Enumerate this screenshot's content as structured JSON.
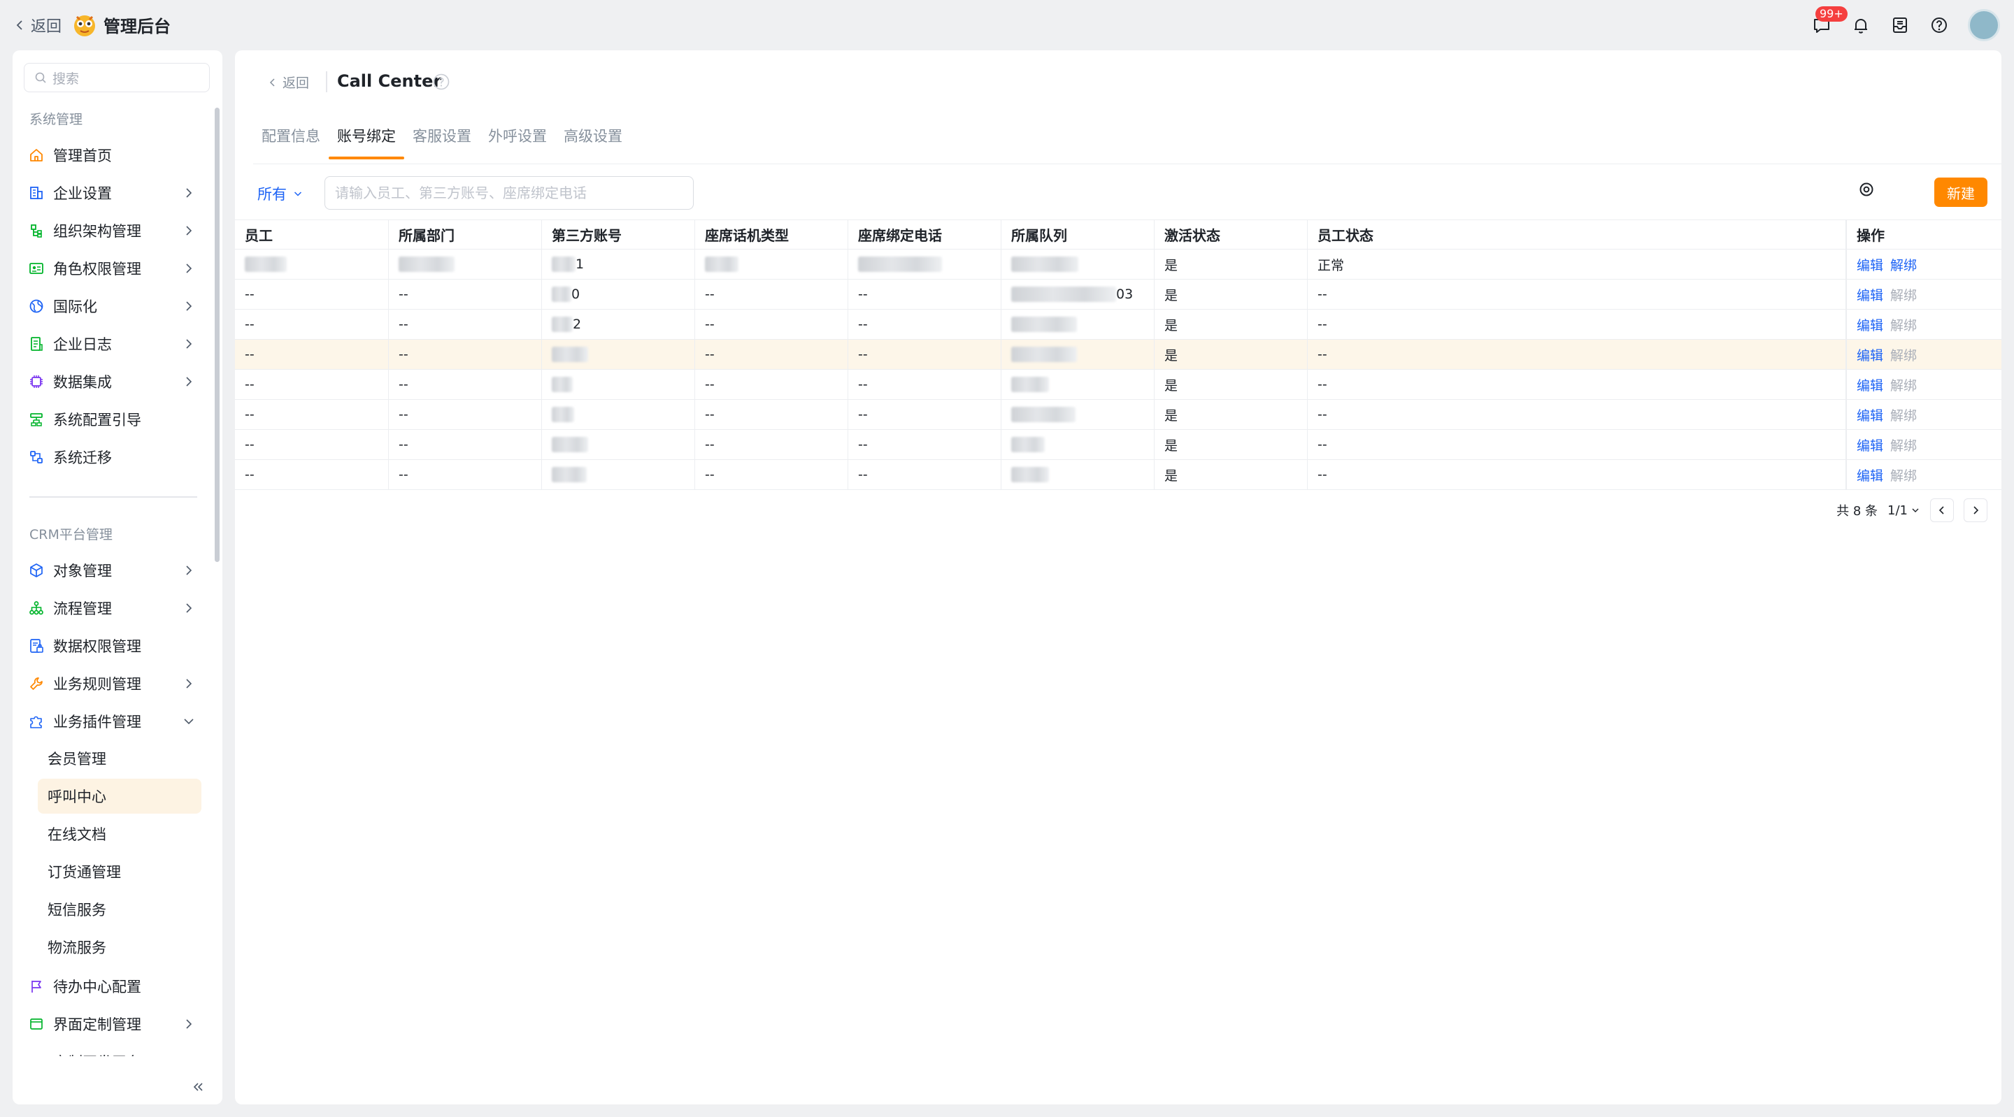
{
  "topbar": {
    "back_label": "返回",
    "app_title": "管理后台",
    "notification_badge": "99+"
  },
  "sidebar": {
    "search_placeholder": "搜索",
    "group1_title": "系统管理",
    "group1_items": [
      {
        "label": "管理首页",
        "icon": "home-icon",
        "has_children": false
      },
      {
        "label": "企业设置",
        "icon": "building-icon",
        "has_children": true
      },
      {
        "label": "组织架构管理",
        "icon": "org-tree-icon",
        "has_children": true
      },
      {
        "label": "角色权限管理",
        "icon": "role-card-icon",
        "has_children": true
      },
      {
        "label": "国际化",
        "icon": "globe-icon",
        "has_children": true
      },
      {
        "label": "企业日志",
        "icon": "log-icon",
        "has_children": true
      },
      {
        "label": "数据集成",
        "icon": "chip-icon",
        "has_children": true
      },
      {
        "label": "系统配置引导",
        "icon": "guide-icon",
        "has_children": false
      },
      {
        "label": "系统迁移",
        "icon": "migrate-icon",
        "has_children": false
      }
    ],
    "group2_title": "CRM平台管理",
    "group2_items": [
      {
        "label": "对象管理",
        "icon": "cube-icon",
        "has_children": true
      },
      {
        "label": "流程管理",
        "icon": "flow-icon",
        "has_children": true
      },
      {
        "label": "数据权限管理",
        "icon": "data-lock-icon",
        "has_children": false
      },
      {
        "label": "业务规则管理",
        "icon": "wrench-icon",
        "has_children": true
      },
      {
        "label": "业务插件管理",
        "icon": "puzzle-icon",
        "has_children": true,
        "expanded": true
      }
    ],
    "plugin_subitems": [
      "会员管理",
      "呼叫中心",
      "在线文档",
      "订货通管理",
      "短信服务",
      "物流服务"
    ],
    "active_subitem": "呼叫中心",
    "group2_items_after": [
      {
        "label": "待办中心配置",
        "icon": "flag-icon",
        "has_children": false
      },
      {
        "label": "界面定制管理",
        "icon": "layout-icon",
        "has_children": true
      },
      {
        "label": "定制开发平台",
        "icon": "code-icon",
        "has_children": true
      }
    ]
  },
  "main": {
    "back_label": "返回",
    "page_title": "Call Center",
    "tabs": [
      "配置信息",
      "账号绑定",
      "客服设置",
      "外呼设置",
      "高级设置"
    ],
    "active_tab": "账号绑定",
    "filter_label": "所有",
    "search_placeholder": "请输入员工、第三方账号、座席绑定电话",
    "new_button": "新建",
    "columns": [
      "员工",
      "所属部门",
      "第三方账号",
      "座席话机类型",
      "座席绑定电话",
      "所属队列",
      "激活状态",
      "员工状态",
      "操作"
    ],
    "rows": [
      {
        "employee": "",
        "dept": "",
        "account": "1",
        "phone_type": "",
        "bound_phone": "",
        "queue": "",
        "active": "是",
        "status": "正常",
        "edit": "编辑",
        "unbind": "解绑",
        "unbind_enabled": true
      },
      {
        "employee": "--",
        "dept": "--",
        "account": "0",
        "phone_type": "--",
        "bound_phone": "--",
        "queue": "03",
        "active": "是",
        "status": "--",
        "edit": "编辑",
        "unbind": "解绑",
        "unbind_enabled": false
      },
      {
        "employee": "--",
        "dept": "--",
        "account": "2",
        "phone_type": "--",
        "bound_phone": "--",
        "queue": "",
        "active": "是",
        "status": "--",
        "edit": "编辑",
        "unbind": "解绑",
        "unbind_enabled": false
      },
      {
        "employee": "--",
        "dept": "--",
        "account": "",
        "phone_type": "--",
        "bound_phone": "--",
        "queue": "",
        "active": "是",
        "status": "--",
        "edit": "编辑",
        "unbind": "解绑",
        "unbind_enabled": false
      },
      {
        "employee": "--",
        "dept": "--",
        "account": "",
        "phone_type": "--",
        "bound_phone": "--",
        "queue": "",
        "active": "是",
        "status": "--",
        "edit": "编辑",
        "unbind": "解绑",
        "unbind_enabled": false
      },
      {
        "employee": "--",
        "dept": "--",
        "account": "",
        "phone_type": "--",
        "bound_phone": "--",
        "queue": "",
        "active": "是",
        "status": "--",
        "edit": "编辑",
        "unbind": "解绑",
        "unbind_enabled": false
      },
      {
        "employee": "--",
        "dept": "--",
        "account": "",
        "phone_type": "--",
        "bound_phone": "--",
        "queue": "",
        "active": "是",
        "status": "--",
        "edit": "编辑",
        "unbind": "解绑",
        "unbind_enabled": false
      },
      {
        "employee": "--",
        "dept": "--",
        "account": "",
        "phone_type": "--",
        "bound_phone": "--",
        "queue": "",
        "active": "是",
        "status": "--",
        "edit": "编辑",
        "unbind": "解绑",
        "unbind_enabled": false
      }
    ],
    "highlighted_row": 3,
    "pagination": {
      "total": "共 8 条",
      "page": "1/1"
    }
  },
  "colors": {
    "accent": "#ff8800",
    "link": "#1d63f5",
    "row_highlight": "#fdf6e9"
  }
}
